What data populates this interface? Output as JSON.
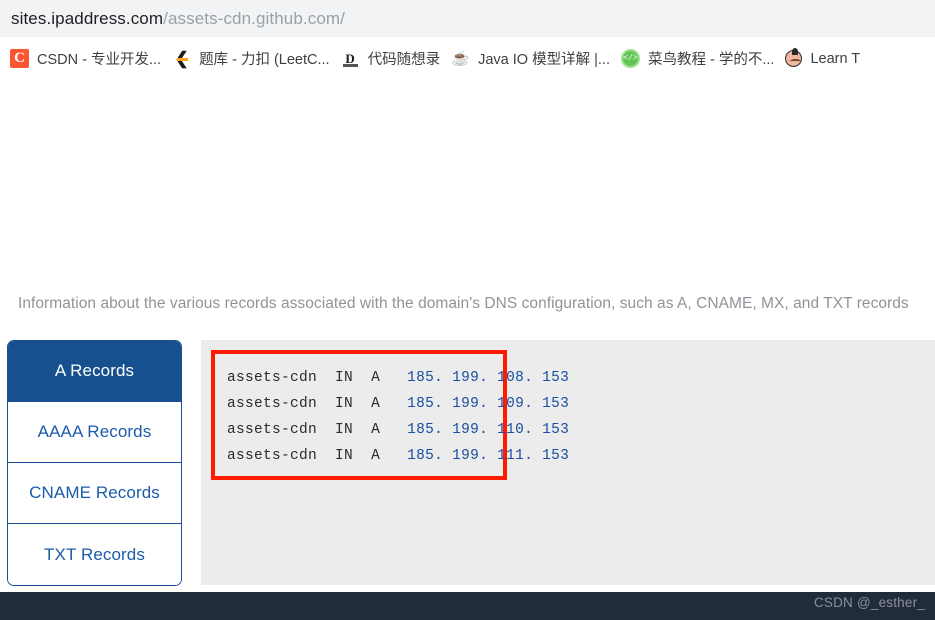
{
  "browser": {
    "url": {
      "host": "sites.ipaddress.com",
      "path": "/assets-cdn.github.com/"
    },
    "bookmarks": [
      {
        "label": "CSDN - 专业开发...",
        "icon": "csdn-icon",
        "glyph": "C"
      },
      {
        "label": "题库 - 力扣 (LeetC...",
        "icon": "leetcode-icon",
        "glyph": "❮"
      },
      {
        "label": "代码随想录",
        "icon": "daima-suixianglu-icon",
        "glyph": "D"
      },
      {
        "label": "Java IO 模型详解 |...",
        "icon": "java-icon",
        "glyph": "☕"
      },
      {
        "label": "菜鸟教程 - 学的不...",
        "icon": "runoob-icon",
        "glyph": ""
      },
      {
        "label": "Learn T",
        "icon": "learn-face-icon",
        "glyph": ""
      }
    ]
  },
  "page": {
    "ghost_heading": "",
    "description": "Information about the various records associated with the domain's DNS configuration, such as A, CNAME, MX, and TXT records"
  },
  "records_widget": {
    "tabs": [
      {
        "label": "A Records",
        "active": true
      },
      {
        "label": "AAAA Records",
        "active": false
      },
      {
        "label": "CNAME Records",
        "active": false
      },
      {
        "label": "TXT Records",
        "active": false
      }
    ],
    "highlight_color": "#ff1a00",
    "active_tab_color": "#17508f",
    "ip_color": "#1a4fa0",
    "a_records": [
      {
        "name": "assets-cdn",
        "class": "IN",
        "type": "A",
        "ip": "185. 199. 108. 153"
      },
      {
        "name": "assets-cdn",
        "class": "IN",
        "type": "A",
        "ip": "185. 199. 109. 153"
      },
      {
        "name": "assets-cdn",
        "class": "IN",
        "type": "A",
        "ip": "185. 199. 110. 153"
      },
      {
        "name": "assets-cdn",
        "class": "IN",
        "type": "A",
        "ip": "185. 199. 111. 153"
      }
    ]
  },
  "footer": {
    "watermark": "CSDN @_esther_"
  }
}
